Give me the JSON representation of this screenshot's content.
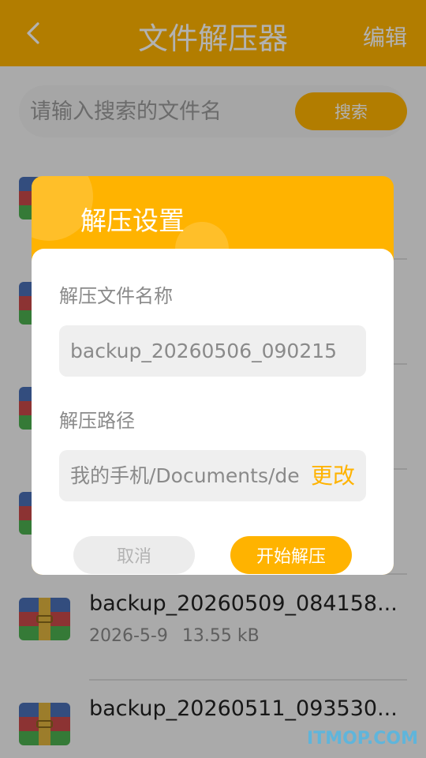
{
  "header": {
    "title": "文件解压器",
    "edit_label": "编辑"
  },
  "search": {
    "placeholder": "请输入搜索的文件名",
    "button_label": "搜索"
  },
  "files": [
    {
      "name": "backup_20260509_084158...",
      "date": "2026-5-9",
      "size": "13.55 kB"
    },
    {
      "name": "backup_20260511_093530...",
      "date": "",
      "size": ""
    }
  ],
  "dialog": {
    "title": "解压设置",
    "name_label": "解压文件名称",
    "name_value": "backup_20260506_090215",
    "path_label": "解压路径",
    "path_value": "我的手机/Documents/decompression",
    "change_label": "更改",
    "cancel_label": "取消",
    "start_label": "开始解压"
  },
  "watermark": "ITMOP.COM",
  "colors": {
    "accent": "#FFB300",
    "watermark": "#4db8e8"
  }
}
